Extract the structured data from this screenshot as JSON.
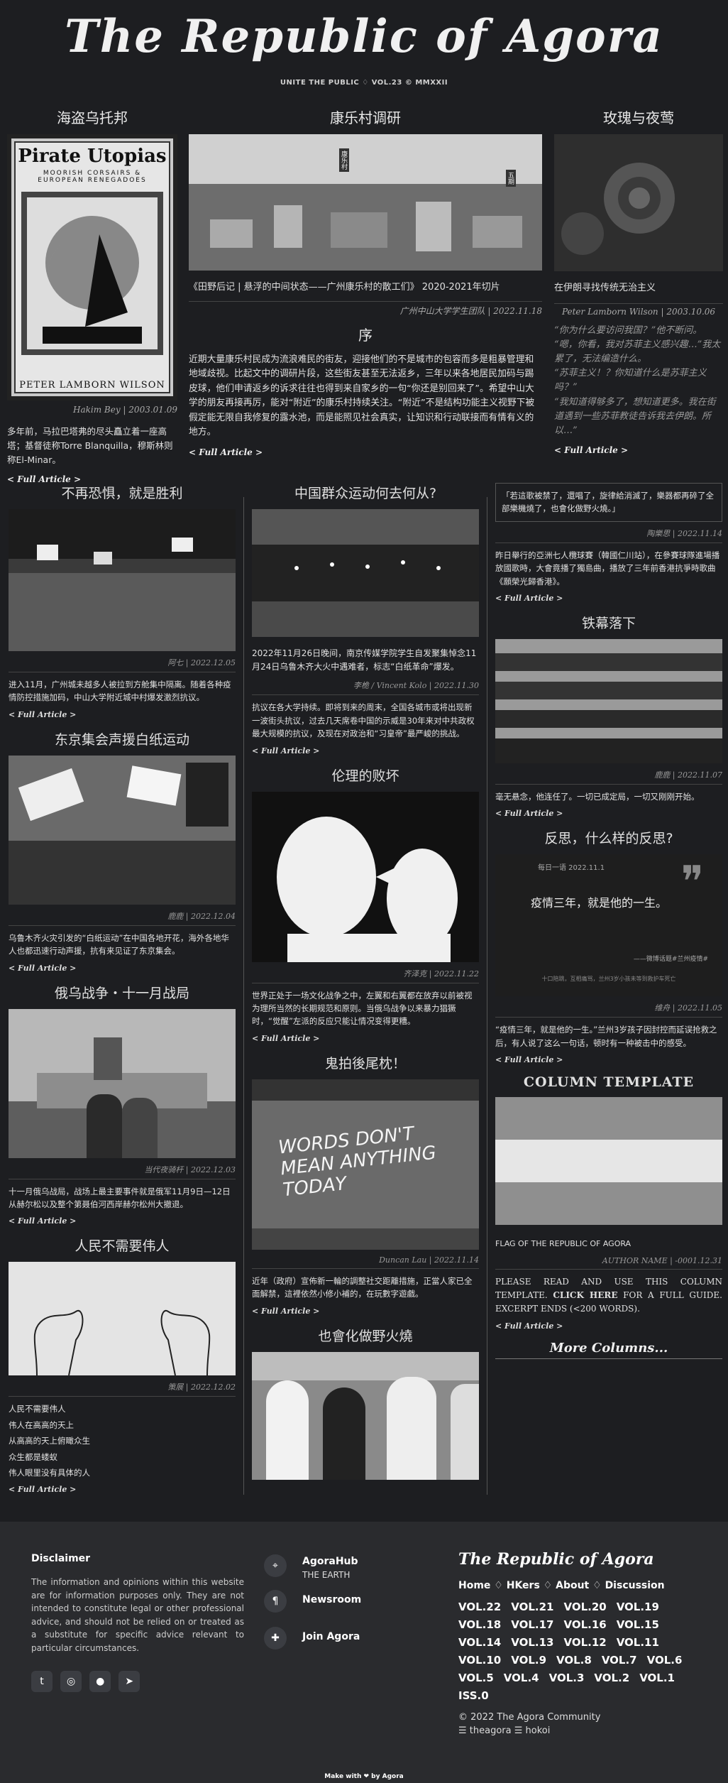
{
  "header": {
    "title": "The Republic of Agora",
    "tagline": "UNITE THE PUBLIC ♢ VOL.23 © MMXXII"
  },
  "top": {
    "left": {
      "title": "海盗乌托邦",
      "cover_title": "Pirate Utopias",
      "cover_sub": "MOORISH CORSAIRS & EUROPEAN RENEGADOES",
      "cover_author": "PETER LAMBORN WILSON",
      "byline": "Hakim Bey | 2003.01.09",
      "text": "多年前，马拉巴塔弗的尽头矗立着一座高塔；基督徒称Torre Blanquilla，穆斯林则称El-Minar。",
      "link": "< Full Article >"
    },
    "center": {
      "title": "康乐村调研",
      "sign1": "康乐村",
      "sign2": "五期",
      "caption": "《田野后记 | 悬浮的中间状态——广州康乐村的散工们》 2020-2021年切片",
      "byline": "广州中山大学学生团队 | 2022.11.18",
      "section": "序",
      "text": "近期大量康乐村民成为流浪难民的街友，迎接他们的不是城市的包容而多是粗暴管理和地域歧视。比起文中的调研片段，这些街友甚至无法返乡，三年以来各地居民加码与踢皮球，他们申请返乡的诉求往往也得到来自家乡的一句“你还是别回来了”。希望中山大学的朋友再接再厉，能对“附近”的康乐村持续关注。“附近”不是结构功能主义视野下被假定能无限自我修复的露水池，而是能照见社会真实，让知识和行动联接而有情有义的地方。",
      "link": "< Full Article >"
    },
    "right": {
      "title": "玫瑰与夜莺",
      "caption": "在伊朗寻找传统无治主义",
      "byline": "Peter Lamborn Wilson | 2003.10.06",
      "quotes": [
        "“你为什么要访问我国？”他不断问。",
        "“嗯，你看，我对苏菲主义感兴趣…”我太累了，无法编造什么。",
        "“苏菲主义！？你知道什么是苏菲主义吗？”",
        "“我知道得够多了，想知道更多。我在街道遇到一些苏菲教徒告诉我去伊朗。所以…”"
      ],
      "link": "< Full Article >"
    }
  },
  "col1": [
    {
      "title": "不再恐惧，就是胜利",
      "byline": "阿七 | 2022.12.05",
      "text": "进入11月，广州城未越多人被拉到方舱集中隔离。随着各种疫情防控措施加码，中山大学附近城中村爆发激烈抗议。",
      "link": "< Full Article >"
    },
    {
      "title": "东京集会声援白纸运动",
      "byline": "鹿鹿 | 2022.12.04",
      "text": "乌鲁木齐火灾引发的“白纸运动”在中国各地开花，海外各地华人也都迅速行动声援，抗有来见证了东京集会。",
      "link": "< Full Article >"
    },
    {
      "title": "俄乌战争・十一月战局",
      "byline": "当代夜骑杆 | 2022.12.03",
      "text": "十一月俄乌战局，战场上最主要事件就是俄军11月9日—12日从赫尔松以及整个第聂伯河西岸赫尔松州大撤退。",
      "link": "< Full Article >"
    },
    {
      "title": "人民不需要伟人",
      "byline": "策展 | 2022.12.02",
      "lines": [
        "人民不需要伟人",
        "伟人在高高的天上",
        "从高高的天上俯瞰众生",
        "众生都是蝼蚁",
        "伟人眼里没有具体的人"
      ],
      "link": "< Full Article >"
    }
  ],
  "col2": [
    {
      "title": "中国群众运动何去何从?",
      "byline": "李桅 / Vincent Kolo | 2022.11.30",
      "pre": "2022年11月26日晚间，南京传媒学院学生自发聚集悼念11月24日乌鲁木齐大火中遇难者，标志“白纸革命”爆发。",
      "text": "抗议在各大学持续。即将到来的周末，全国各城市或将出现新一波街头抗议，过去几天席卷中国的示威是30年来对中共政权最大规模的抗议，及现在对政治和“习皇帝”最严峻的挑战。",
      "link": "< Full Article >"
    },
    {
      "title": "伦理的败坏",
      "byline": "齐泽克 | 2022.11.22",
      "text": "世界正处于一场文化战争之中，左翼和右翼都在放弃以前被视为理所当然的长期规范和原则。当俄乌战争以来暴力猖獗时，“觉醒”左派的反应只能让情况变得更糟。",
      "link": "< Full Article >"
    },
    {
      "title": "鬼拍後尾枕！",
      "byline": "Duncan Lau | 2022.11.14",
      "graffiti": "WORDS DON'T MEAN ANYTHING TODAY",
      "text": "近年（政府）宣佈新一輪的調整社交距離措施，正當人家已全面解禁，這裡依然小修小補的，在玩數字遊戲。",
      "link": "< Full Article >"
    },
    {
      "title": "也會化做野火燒"
    }
  ],
  "col3": [
    {
      "quote": "「若這歌被禁了，還唱了，旋律給消滅了，樂器都再碎了全部樂機燒了，也會化做野火燒。」",
      "byline": "陶樂思 | 2022.11.14",
      "text": "昨日舉行的亞洲七人欖球賽（韓國仁川站），在參賽球隊進場播放國歌時，大會竟播了獨島曲，播放了三年前香港抗爭時歌曲《願榮光歸香港》。",
      "link": "< Full Article >"
    },
    {
      "title": "铁幕落下",
      "byline": "鹿鹿 | 2022.11.07",
      "text": "毫无悬念，他连任了。一切已成定局，一切又刚刚开始。",
      "link": "< Full Article >"
    },
    {
      "title": "反思，什么样的反思?",
      "img_date": "每日一语 2022.11.1",
      "img_quote": "疫情三年，就是他的一生。",
      "img_sign": "——微博话题#兰州疫情#",
      "img_foot": "十口陪跳，互相痛骂，兰州3岁小孩未等到救护车死亡",
      "byline": "维舟 | 2022.11.05",
      "text": "“疫情三年，就是他的一生。”兰州3岁孩子因封控而延误抢救之后，有人说了这么一句话，顿时有一种被击中的感受。",
      "link": "< Full Article >"
    },
    {
      "title": "COLUMN TEMPLATE",
      "caption": "FLAG OF THE REPUBLIC OF AGORA",
      "byline": "AUTHOR NAME | -0001.12.31",
      "text_pre": "PLEASE READ AND USE THIS COLUMN TEMPLATE.",
      "text_link": "CLICK HERE",
      "text_post": "FOR A FULL GUIDE. EXCERPT ENDS (<200 WORDS).",
      "link": "< Full Article >",
      "more": "More Columns..."
    }
  ],
  "footer": {
    "disclaimer_title": "Disclaimer",
    "disclaimer": "The information and opinions within this website are for information purposes only. They are not intended to constitute legal or other professional advice, and should not be relied on or treated as a substitute for specific advice relevant to particular circumstances.",
    "social": [
      "twitter-icon",
      "github-icon",
      "reddit-icon",
      "telegram-icon"
    ],
    "nav": [
      {
        "label": "AgoraHub",
        "sub": "THE EARTH"
      },
      {
        "label": "Newsroom",
        "sub": ""
      },
      {
        "label": "Join Agora",
        "sub": ""
      }
    ],
    "brand": "The Republic of Agora",
    "links": [
      "Home",
      "HKers",
      "About",
      "Discussion"
    ],
    "vols": [
      "VOL.22",
      "VOL.21",
      "VOL.20",
      "VOL.19",
      "VOL.18",
      "VOL.17",
      "VOL.16",
      "VOL.15",
      "VOL.14",
      "VOL.13",
      "VOL.12",
      "VOL.11",
      "VOL.10",
      "VOL.9",
      "VOL.8",
      "VOL.7",
      "VOL.6",
      "VOL.5",
      "VOL.4",
      "VOL.3",
      "VOL.2",
      "VOL.1",
      "ISS.0"
    ],
    "copyright": "© 2022 The Agora Community",
    "credits": "☰ theagora ☰ hokoi",
    "made": "Make with ❤ by Agora"
  },
  "colors": {
    "bg": "#1d1e21",
    "footer": "#2a2b2e",
    "text": "#e0e0e0"
  }
}
